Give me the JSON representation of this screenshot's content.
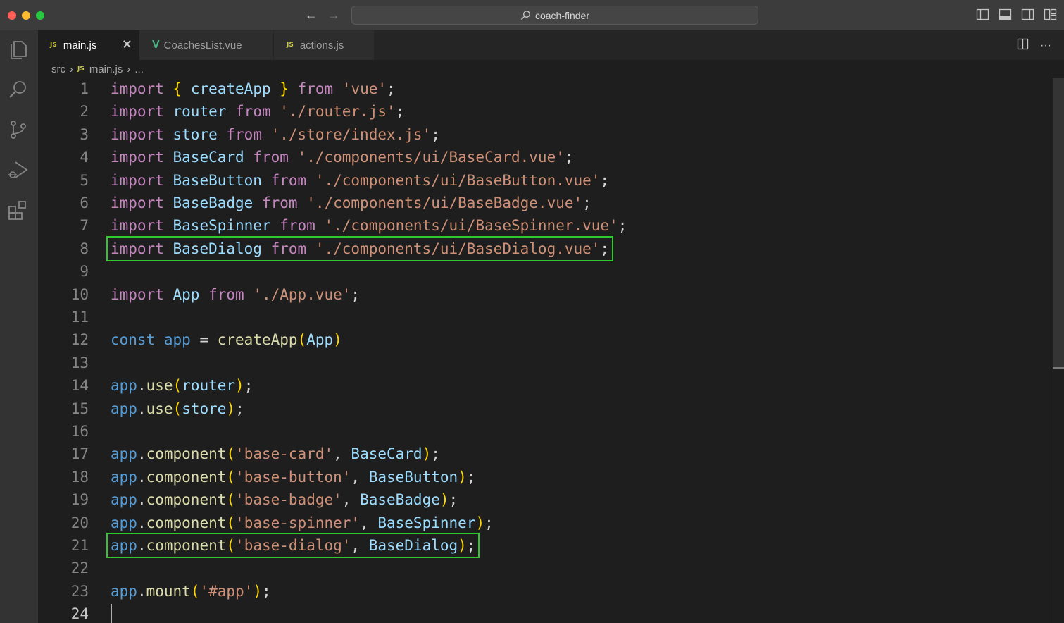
{
  "window": {
    "title": "coach-finder"
  },
  "tabs": [
    {
      "label": "main.js",
      "type": "js",
      "badge": "JS",
      "active": true
    },
    {
      "label": "CoachesList.vue",
      "type": "vue",
      "badge": "V",
      "active": false
    },
    {
      "label": "actions.js",
      "type": "js",
      "badge": "JS",
      "active": false
    }
  ],
  "breadcrumb": {
    "folder": "src",
    "file_badge": "JS",
    "file": "main.js",
    "more": "..."
  },
  "activity_icons": [
    "explorer-icon",
    "search-icon",
    "source-control-icon",
    "run-debug-icon",
    "extensions-icon"
  ],
  "editor": {
    "highlighted_lines": [
      8,
      21
    ],
    "cursor_line": 24,
    "lines": [
      {
        "n": "1",
        "tokens": [
          [
            "kw",
            "import"
          ],
          [
            "plain",
            " "
          ],
          [
            "br1",
            "{"
          ],
          [
            "plain",
            " "
          ],
          [
            "var",
            "createApp"
          ],
          [
            "plain",
            " "
          ],
          [
            "br1",
            "}"
          ],
          [
            "plain",
            " "
          ],
          [
            "kw",
            "from"
          ],
          [
            "plain",
            " "
          ],
          [
            "str",
            "'vue'"
          ],
          [
            "plain",
            ";"
          ]
        ]
      },
      {
        "n": "2",
        "tokens": [
          [
            "kw",
            "import"
          ],
          [
            "plain",
            " "
          ],
          [
            "var",
            "router"
          ],
          [
            "plain",
            " "
          ],
          [
            "kw",
            "from"
          ],
          [
            "plain",
            " "
          ],
          [
            "str",
            "'./router.js'"
          ],
          [
            "plain",
            ";"
          ]
        ]
      },
      {
        "n": "3",
        "tokens": [
          [
            "kw",
            "import"
          ],
          [
            "plain",
            " "
          ],
          [
            "var",
            "store"
          ],
          [
            "plain",
            " "
          ],
          [
            "kw",
            "from"
          ],
          [
            "plain",
            " "
          ],
          [
            "str",
            "'./store/index.js'"
          ],
          [
            "plain",
            ";"
          ]
        ]
      },
      {
        "n": "4",
        "tokens": [
          [
            "kw",
            "import"
          ],
          [
            "plain",
            " "
          ],
          [
            "var",
            "BaseCard"
          ],
          [
            "plain",
            " "
          ],
          [
            "kw",
            "from"
          ],
          [
            "plain",
            " "
          ],
          [
            "str",
            "'./components/ui/BaseCard.vue'"
          ],
          [
            "plain",
            ";"
          ]
        ]
      },
      {
        "n": "5",
        "tokens": [
          [
            "kw",
            "import"
          ],
          [
            "plain",
            " "
          ],
          [
            "var",
            "BaseButton"
          ],
          [
            "plain",
            " "
          ],
          [
            "kw",
            "from"
          ],
          [
            "plain",
            " "
          ],
          [
            "str",
            "'./components/ui/BaseButton.vue'"
          ],
          [
            "plain",
            ";"
          ]
        ]
      },
      {
        "n": "6",
        "tokens": [
          [
            "kw",
            "import"
          ],
          [
            "plain",
            " "
          ],
          [
            "var",
            "BaseBadge"
          ],
          [
            "plain",
            " "
          ],
          [
            "kw",
            "from"
          ],
          [
            "plain",
            " "
          ],
          [
            "str",
            "'./components/ui/BaseBadge.vue'"
          ],
          [
            "plain",
            ";"
          ]
        ]
      },
      {
        "n": "7",
        "tokens": [
          [
            "kw",
            "import"
          ],
          [
            "plain",
            " "
          ],
          [
            "var",
            "BaseSpinner"
          ],
          [
            "plain",
            " "
          ],
          [
            "kw",
            "from"
          ],
          [
            "plain",
            " "
          ],
          [
            "str",
            "'./components/ui/BaseSpinner.vue'"
          ],
          [
            "plain",
            ";"
          ]
        ]
      },
      {
        "n": "8",
        "tokens": [
          [
            "kw",
            "import"
          ],
          [
            "plain",
            " "
          ],
          [
            "var",
            "BaseDialog"
          ],
          [
            "plain",
            " "
          ],
          [
            "kw",
            "from"
          ],
          [
            "plain",
            " "
          ],
          [
            "str",
            "'./components/ui/BaseDialog.vue'"
          ],
          [
            "plain",
            ";"
          ]
        ]
      },
      {
        "n": "9",
        "tokens": []
      },
      {
        "n": "10",
        "tokens": [
          [
            "kw",
            "import"
          ],
          [
            "plain",
            " "
          ],
          [
            "var",
            "App"
          ],
          [
            "plain",
            " "
          ],
          [
            "kw",
            "from"
          ],
          [
            "plain",
            " "
          ],
          [
            "str",
            "'./App.vue'"
          ],
          [
            "plain",
            ";"
          ]
        ]
      },
      {
        "n": "11",
        "tokens": []
      },
      {
        "n": "12",
        "tokens": [
          [
            "const",
            "const"
          ],
          [
            "plain",
            " "
          ],
          [
            "const",
            "app"
          ],
          [
            "plain",
            " = "
          ],
          [
            "fn",
            "createApp"
          ],
          [
            "br1",
            "("
          ],
          [
            "var",
            "App"
          ],
          [
            "br1",
            ")"
          ]
        ]
      },
      {
        "n": "13",
        "tokens": []
      },
      {
        "n": "14",
        "tokens": [
          [
            "const",
            "app"
          ],
          [
            "plain",
            "."
          ],
          [
            "fn",
            "use"
          ],
          [
            "br1",
            "("
          ],
          [
            "var",
            "router"
          ],
          [
            "br1",
            ")"
          ],
          [
            "plain",
            ";"
          ]
        ]
      },
      {
        "n": "15",
        "tokens": [
          [
            "const",
            "app"
          ],
          [
            "plain",
            "."
          ],
          [
            "fn",
            "use"
          ],
          [
            "br1",
            "("
          ],
          [
            "var",
            "store"
          ],
          [
            "br1",
            ")"
          ],
          [
            "plain",
            ";"
          ]
        ]
      },
      {
        "n": "16",
        "tokens": []
      },
      {
        "n": "17",
        "tokens": [
          [
            "const",
            "app"
          ],
          [
            "plain",
            "."
          ],
          [
            "fn",
            "component"
          ],
          [
            "br1",
            "("
          ],
          [
            "str",
            "'base-card'"
          ],
          [
            "plain",
            ", "
          ],
          [
            "var",
            "BaseCard"
          ],
          [
            "br1",
            ")"
          ],
          [
            "plain",
            ";"
          ]
        ]
      },
      {
        "n": "18",
        "tokens": [
          [
            "const",
            "app"
          ],
          [
            "plain",
            "."
          ],
          [
            "fn",
            "component"
          ],
          [
            "br1",
            "("
          ],
          [
            "str",
            "'base-button'"
          ],
          [
            "plain",
            ", "
          ],
          [
            "var",
            "BaseButton"
          ],
          [
            "br1",
            ")"
          ],
          [
            "plain",
            ";"
          ]
        ]
      },
      {
        "n": "19",
        "tokens": [
          [
            "const",
            "app"
          ],
          [
            "plain",
            "."
          ],
          [
            "fn",
            "component"
          ],
          [
            "br1",
            "("
          ],
          [
            "str",
            "'base-badge'"
          ],
          [
            "plain",
            ", "
          ],
          [
            "var",
            "BaseBadge"
          ],
          [
            "br1",
            ")"
          ],
          [
            "plain",
            ";"
          ]
        ]
      },
      {
        "n": "20",
        "tokens": [
          [
            "const",
            "app"
          ],
          [
            "plain",
            "."
          ],
          [
            "fn",
            "component"
          ],
          [
            "br1",
            "("
          ],
          [
            "str",
            "'base-spinner'"
          ],
          [
            "plain",
            ", "
          ],
          [
            "var",
            "BaseSpinner"
          ],
          [
            "br1",
            ")"
          ],
          [
            "plain",
            ";"
          ]
        ]
      },
      {
        "n": "21",
        "tokens": [
          [
            "const",
            "app"
          ],
          [
            "plain",
            "."
          ],
          [
            "fn",
            "component"
          ],
          [
            "br1",
            "("
          ],
          [
            "str",
            "'base-dialog'"
          ],
          [
            "plain",
            ", "
          ],
          [
            "var",
            "BaseDialog"
          ],
          [
            "br1",
            ")"
          ],
          [
            "plain",
            ";"
          ]
        ]
      },
      {
        "n": "22",
        "tokens": []
      },
      {
        "n": "23",
        "tokens": [
          [
            "const",
            "app"
          ],
          [
            "plain",
            "."
          ],
          [
            "fn",
            "mount"
          ],
          [
            "br1",
            "("
          ],
          [
            "str",
            "'#app'"
          ],
          [
            "br1",
            ")"
          ],
          [
            "plain",
            ";"
          ]
        ]
      },
      {
        "n": "24",
        "tokens": []
      }
    ]
  },
  "colors": {
    "highlight_box": "#2fc92f",
    "keyword": "#c586c0",
    "string": "#ce9178",
    "variable": "#9cdcfe",
    "function": "#dcdcaa",
    "const": "#569cd6"
  }
}
